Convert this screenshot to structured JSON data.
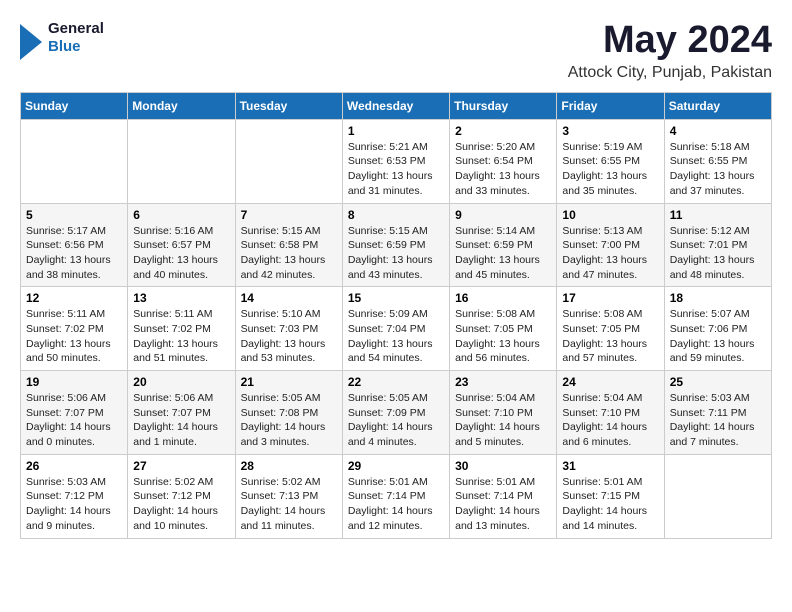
{
  "header": {
    "logo_general": "General",
    "logo_blue": "Blue",
    "month_title": "May 2024",
    "location": "Attock City, Punjab, Pakistan"
  },
  "calendar": {
    "days_of_week": [
      "Sunday",
      "Monday",
      "Tuesday",
      "Wednesday",
      "Thursday",
      "Friday",
      "Saturday"
    ],
    "weeks": [
      [
        {
          "day": "",
          "info": ""
        },
        {
          "day": "",
          "info": ""
        },
        {
          "day": "",
          "info": ""
        },
        {
          "day": "1",
          "info": "Sunrise: 5:21 AM\nSunset: 6:53 PM\nDaylight: 13 hours\nand 31 minutes."
        },
        {
          "day": "2",
          "info": "Sunrise: 5:20 AM\nSunset: 6:54 PM\nDaylight: 13 hours\nand 33 minutes."
        },
        {
          "day": "3",
          "info": "Sunrise: 5:19 AM\nSunset: 6:55 PM\nDaylight: 13 hours\nand 35 minutes."
        },
        {
          "day": "4",
          "info": "Sunrise: 5:18 AM\nSunset: 6:55 PM\nDaylight: 13 hours\nand 37 minutes."
        }
      ],
      [
        {
          "day": "5",
          "info": "Sunrise: 5:17 AM\nSunset: 6:56 PM\nDaylight: 13 hours\nand 38 minutes."
        },
        {
          "day": "6",
          "info": "Sunrise: 5:16 AM\nSunset: 6:57 PM\nDaylight: 13 hours\nand 40 minutes."
        },
        {
          "day": "7",
          "info": "Sunrise: 5:15 AM\nSunset: 6:58 PM\nDaylight: 13 hours\nand 42 minutes."
        },
        {
          "day": "8",
          "info": "Sunrise: 5:15 AM\nSunset: 6:59 PM\nDaylight: 13 hours\nand 43 minutes."
        },
        {
          "day": "9",
          "info": "Sunrise: 5:14 AM\nSunset: 6:59 PM\nDaylight: 13 hours\nand 45 minutes."
        },
        {
          "day": "10",
          "info": "Sunrise: 5:13 AM\nSunset: 7:00 PM\nDaylight: 13 hours\nand 47 minutes."
        },
        {
          "day": "11",
          "info": "Sunrise: 5:12 AM\nSunset: 7:01 PM\nDaylight: 13 hours\nand 48 minutes."
        }
      ],
      [
        {
          "day": "12",
          "info": "Sunrise: 5:11 AM\nSunset: 7:02 PM\nDaylight: 13 hours\nand 50 minutes."
        },
        {
          "day": "13",
          "info": "Sunrise: 5:11 AM\nSunset: 7:02 PM\nDaylight: 13 hours\nand 51 minutes."
        },
        {
          "day": "14",
          "info": "Sunrise: 5:10 AM\nSunset: 7:03 PM\nDaylight: 13 hours\nand 53 minutes."
        },
        {
          "day": "15",
          "info": "Sunrise: 5:09 AM\nSunset: 7:04 PM\nDaylight: 13 hours\nand 54 minutes."
        },
        {
          "day": "16",
          "info": "Sunrise: 5:08 AM\nSunset: 7:05 PM\nDaylight: 13 hours\nand 56 minutes."
        },
        {
          "day": "17",
          "info": "Sunrise: 5:08 AM\nSunset: 7:05 PM\nDaylight: 13 hours\nand 57 minutes."
        },
        {
          "day": "18",
          "info": "Sunrise: 5:07 AM\nSunset: 7:06 PM\nDaylight: 13 hours\nand 59 minutes."
        }
      ],
      [
        {
          "day": "19",
          "info": "Sunrise: 5:06 AM\nSunset: 7:07 PM\nDaylight: 14 hours\nand 0 minutes."
        },
        {
          "day": "20",
          "info": "Sunrise: 5:06 AM\nSunset: 7:07 PM\nDaylight: 14 hours\nand 1 minute."
        },
        {
          "day": "21",
          "info": "Sunrise: 5:05 AM\nSunset: 7:08 PM\nDaylight: 14 hours\nand 3 minutes."
        },
        {
          "day": "22",
          "info": "Sunrise: 5:05 AM\nSunset: 7:09 PM\nDaylight: 14 hours\nand 4 minutes."
        },
        {
          "day": "23",
          "info": "Sunrise: 5:04 AM\nSunset: 7:10 PM\nDaylight: 14 hours\nand 5 minutes."
        },
        {
          "day": "24",
          "info": "Sunrise: 5:04 AM\nSunset: 7:10 PM\nDaylight: 14 hours\nand 6 minutes."
        },
        {
          "day": "25",
          "info": "Sunrise: 5:03 AM\nSunset: 7:11 PM\nDaylight: 14 hours\nand 7 minutes."
        }
      ],
      [
        {
          "day": "26",
          "info": "Sunrise: 5:03 AM\nSunset: 7:12 PM\nDaylight: 14 hours\nand 9 minutes."
        },
        {
          "day": "27",
          "info": "Sunrise: 5:02 AM\nSunset: 7:12 PM\nDaylight: 14 hours\nand 10 minutes."
        },
        {
          "day": "28",
          "info": "Sunrise: 5:02 AM\nSunset: 7:13 PM\nDaylight: 14 hours\nand 11 minutes."
        },
        {
          "day": "29",
          "info": "Sunrise: 5:01 AM\nSunset: 7:14 PM\nDaylight: 14 hours\nand 12 minutes."
        },
        {
          "day": "30",
          "info": "Sunrise: 5:01 AM\nSunset: 7:14 PM\nDaylight: 14 hours\nand 13 minutes."
        },
        {
          "day": "31",
          "info": "Sunrise: 5:01 AM\nSunset: 7:15 PM\nDaylight: 14 hours\nand 14 minutes."
        },
        {
          "day": "",
          "info": ""
        }
      ]
    ]
  }
}
